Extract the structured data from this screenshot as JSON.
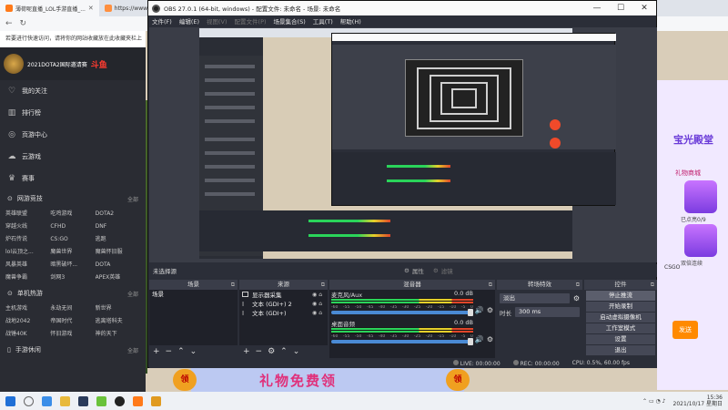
{
  "browser": {
    "tabs": [
      {
        "title": "薄荷呢直播_LOL手游直播_...",
        "active": true
      },
      {
        "title": "https://www.douyu...",
        "active": false
      }
    ],
    "notice": "若要进行快速访问，请将你的网站收藏放在此收藏夹栏上"
  },
  "douyu": {
    "brand": "2021DOTA2国际邀请赛",
    "logo_text": "斗鱼",
    "nav": [
      {
        "label": "我的关注",
        "icon": "heart-icon"
      },
      {
        "label": "排行榜",
        "icon": "rank-icon"
      },
      {
        "label": "页游中心",
        "icon": "gamepad-icon"
      },
      {
        "label": "云游戏",
        "icon": "cloud-icon"
      },
      {
        "label": "赛事",
        "icon": "trophy-icon"
      }
    ],
    "sections": [
      {
        "title": "网游竞技",
        "more": "全部",
        "items": [
          "英雄联盟",
          "吃鸡游戏",
          "DOTA2",
          "穿越火线",
          "CFHD",
          "DNF",
          "炉石传说",
          "CS:GO",
          "逃跑",
          "lol云顶之...",
          "魔兽世界",
          "魔兽怀旧服",
          "风暴英雄",
          "暗黑破坏...",
          "DOTA",
          "魔兽争霸",
          "剑网3",
          "APEX英雄"
        ]
      },
      {
        "title": "单机热游",
        "more": "全部",
        "items": [
          "主机游戏",
          "永劫无间",
          "新世界",
          "战地2042",
          "帝国时代",
          "逃离塔科夫",
          "战锤40K",
          "怀旧游戏",
          "神的天下"
        ]
      },
      {
        "title": "手游休闲",
        "more": "全部",
        "items": []
      }
    ]
  },
  "promo": {
    "title": "宝光殿堂",
    "subtitle": "礼物商城",
    "item1": "已点亮0/9",
    "item2": "已点亮0/9",
    "item3": "双倍连续",
    "cs_label": "CSGO",
    "send": "发送"
  },
  "banner": {
    "text": "礼物免费领",
    "ling": "领"
  },
  "obs": {
    "title": "OBS 27.0.1 (64-bit, windows) - 配置文件: 未命名 - 场景: 未命名",
    "menu": [
      "文件(F)",
      "编辑(E)",
      "视图(V)",
      "配置文件(P)",
      "场景集合(S)",
      "工具(T)",
      "帮助(H)"
    ],
    "no_source": "未选择源",
    "props_label": "属性",
    "filters_label": "滤镜",
    "docks": {
      "scenes": {
        "title": "场景",
        "items": [
          "场景"
        ]
      },
      "sources": {
        "title": "来源",
        "items": [
          {
            "name": "显示器采集",
            "type": "monitor"
          },
          {
            "name": "文本 (GDI+) 2",
            "type": "text"
          },
          {
            "name": "文本 (GDI+)",
            "type": "text"
          }
        ]
      },
      "mixer": {
        "title": "混音器",
        "channels": [
          {
            "name": "麦克风/Aux",
            "db": "0.0 dB"
          },
          {
            "name": "桌面音频",
            "db": "0.0 dB"
          }
        ],
        "ticks": [
          "-60",
          "-55",
          "-50",
          "-45",
          "-40",
          "-35",
          "-30",
          "-25",
          "-20",
          "-15",
          "-10",
          "-5",
          "0"
        ]
      },
      "transitions": {
        "title": "转场特效",
        "selected": "淡出",
        "duration_label": "时长",
        "duration_value": "300 ms"
      },
      "controls": {
        "title": "控件",
        "buttons": [
          "停止推流",
          "开始录制",
          "启动虚拟摄像机",
          "工作室模式",
          "设置",
          "退出"
        ]
      }
    },
    "status": {
      "live": "LIVE: 00:00:00",
      "rec": "REC: 00:00:00",
      "cpu": "CPU: 0.5%, 60.00 fps"
    }
  },
  "taskbar": {
    "time": "15:36",
    "date": "2021/10/17 星期日"
  }
}
